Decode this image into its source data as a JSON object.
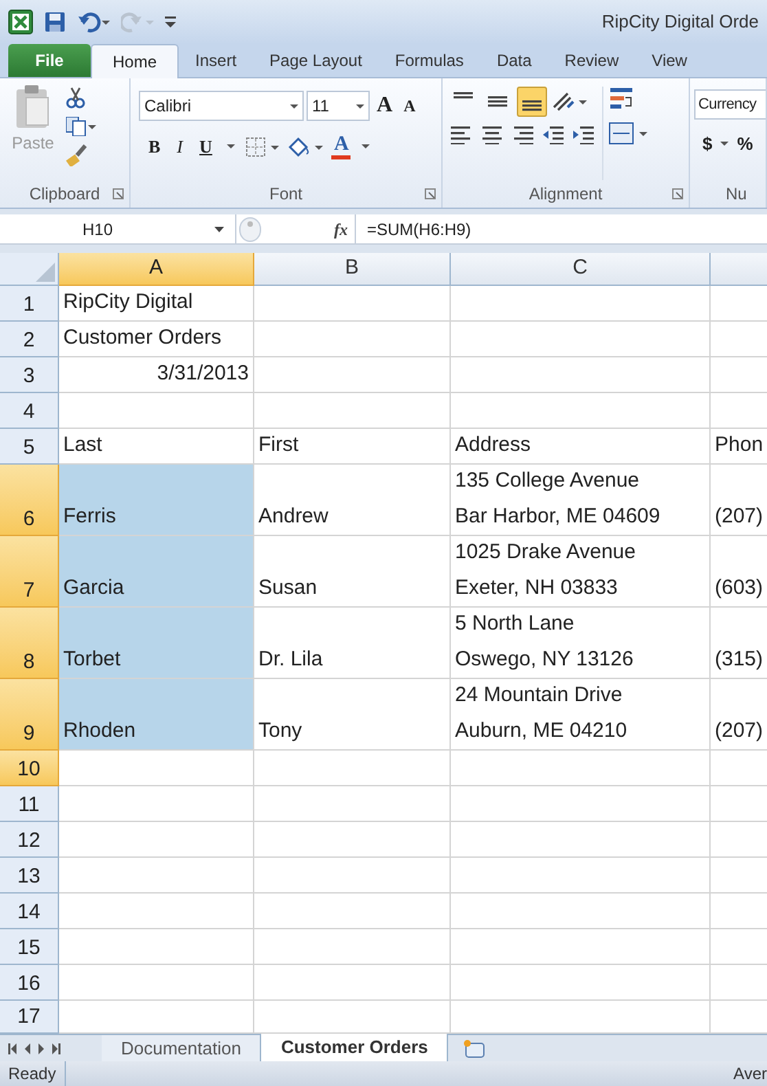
{
  "window": {
    "title": "RipCity Digital Orde"
  },
  "tabs": [
    {
      "label": "File",
      "kind": "file",
      "selected": false
    },
    {
      "label": "Home",
      "kind": "tab",
      "selected": true
    },
    {
      "label": "Insert",
      "kind": "tab",
      "selected": false
    },
    {
      "label": "Page Layout",
      "kind": "tab",
      "selected": false
    },
    {
      "label": "Formulas",
      "kind": "tab",
      "selected": false
    },
    {
      "label": "Data",
      "kind": "tab",
      "selected": false
    },
    {
      "label": "Review",
      "kind": "tab",
      "selected": false
    },
    {
      "label": "View",
      "kind": "tab",
      "selected": false
    }
  ],
  "ribbon": {
    "clipboard": {
      "paste": "Paste",
      "label": "Clipboard"
    },
    "font": {
      "name": "Calibri",
      "size_box": "11",
      "grow": "A",
      "shrink": "A",
      "bold": "B",
      "italic": "I",
      "underline": "U",
      "text_tool": "A",
      "label": "Font"
    },
    "alignment": {
      "vertical": [
        {
          "selected": false
        },
        {
          "selected": false
        },
        {
          "selected": true
        }
      ],
      "label": "Alignment"
    },
    "number": {
      "format": "Currency",
      "dollar": "$",
      "percent": "%",
      "label": "Nu"
    }
  },
  "formula_bar": {
    "name_box": "H10",
    "fx": "fx",
    "formula": "=SUM(H6:H9)"
  },
  "columns": [
    {
      "label": "A",
      "selected": true
    },
    {
      "label": "B",
      "selected": false
    },
    {
      "label": "C",
      "selected": false
    },
    {
      "selected": false
    }
  ],
  "rows": [
    {
      "label": "1",
      "selected": false,
      "cells": [
        {
          "text": "RipCity Digital",
          "selected": false
        }
      ]
    },
    {
      "label": "2",
      "selected": false,
      "cells": [
        {
          "text": "Customer Orders",
          "selected": false
        }
      ]
    },
    {
      "label": "3",
      "selected": false,
      "cells": [
        {
          "text": "3/31/2013",
          "kind": "date",
          "selected": false
        }
      ]
    },
    {
      "label": "4",
      "selected": false,
      "cells": []
    },
    {
      "label": "5",
      "selected": false,
      "cells": [
        {
          "text": "Last",
          "selected": false
        },
        {
          "text": "First",
          "selected": false
        },
        {
          "text": "Address",
          "selected": false
        },
        {
          "text": "Phon",
          "selected": false
        }
      ]
    },
    {
      "label": "6",
      "selected": true,
      "tall": true,
      "cells": [
        {
          "text": "Ferris",
          "selected": true
        },
        {
          "text": "Andrew",
          "selected": false
        },
        {
          "text": "135 College Avenue\nBar Harbor, ME 04609",
          "selected": false
        },
        {
          "text": "(207)",
          "selected": false
        }
      ]
    },
    {
      "label": "7",
      "selected": true,
      "tall": true,
      "cells": [
        {
          "text": "Garcia",
          "selected": true
        },
        {
          "text": "Susan",
          "selected": false
        },
        {
          "text": "1025 Drake Avenue\nExeter, NH 03833",
          "selected": false
        },
        {
          "text": "(603)",
          "selected": false
        }
      ]
    },
    {
      "label": "8",
      "selected": true,
      "tall": true,
      "cells": [
        {
          "text": "Torbet",
          "selected": true
        },
        {
          "text": "Dr. Lila",
          "selected": false
        },
        {
          "text": "5 North Lane\nOswego, NY 13126",
          "selected": false
        },
        {
          "text": "(315)",
          "selected": false
        }
      ]
    },
    {
      "label": "9",
      "selected": true,
      "tall": true,
      "cells": [
        {
          "text": "Rhoden",
          "selected": true
        },
        {
          "text": "Tony",
          "selected": false
        },
        {
          "text": "24 Mountain Drive\nAuburn, ME 04210",
          "selected": false
        },
        {
          "text": "(207)",
          "selected": false
        }
      ]
    },
    {
      "label": "10",
      "selected": true,
      "cells": []
    },
    {
      "label": "11",
      "selected": false,
      "cells": []
    },
    {
      "label": "12",
      "selected": false,
      "cells": []
    },
    {
      "label": "13",
      "selected": false,
      "cells": []
    },
    {
      "label": "14",
      "selected": false,
      "cells": []
    },
    {
      "label": "15",
      "selected": false,
      "cells": []
    },
    {
      "label": "16",
      "selected": false,
      "cells": []
    },
    {
      "label": "17",
      "selected": false,
      "cells": []
    }
  ],
  "sheet_tabs": [
    {
      "label": "Documentation",
      "selected": false
    },
    {
      "label": "Customer Orders",
      "selected": true
    }
  ],
  "status_bar": {
    "state": "Ready",
    "summary": "Aver"
  }
}
